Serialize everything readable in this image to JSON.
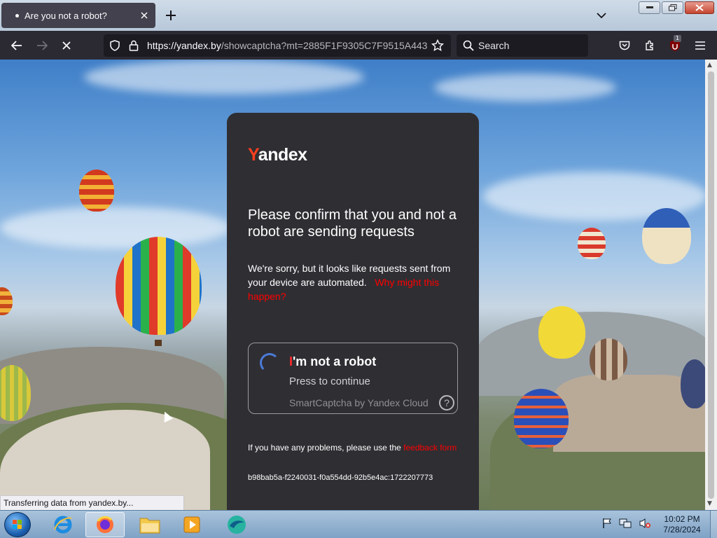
{
  "browser": {
    "tab_title": "Are you not a robot?",
    "url_domain": "https://yandex.by",
    "url_path": "/showcaptcha?mt=2885F1F9305C7F9515A443",
    "search_placeholder": "Search",
    "extension_badge": "1",
    "status_text": "Transferring data from yandex.by..."
  },
  "captcha": {
    "logo_first": "Y",
    "logo_rest": "andex",
    "heading": "Please confirm that you and not a robot are sending requests",
    "description": "We're sorry, but it looks like requests sent from your device are automated.",
    "why_link": "Why might this happen?",
    "checkbox_label_first": "I",
    "checkbox_label_rest": "'m not a robot",
    "press_label": "Press to continue",
    "provider": "SmartCaptcha by Yandex Cloud",
    "help_glyph": "?",
    "problems_text": "If you have any problems, please use the",
    "feedback_link": "feedback form",
    "request_id": "b98bab5a-f2240031-f0a554dd-92b5e4ac:1722207773"
  },
  "taskbar": {
    "time": "10:02 PM",
    "date": "7/28/2024",
    "apps": [
      "internet-explorer",
      "firefox",
      "file-explorer",
      "media-player",
      "browser-app"
    ]
  },
  "colors": {
    "yandex_red": "#fc3f1d",
    "link_red": "#ff0000",
    "card_bg": "#2f2e33",
    "spinner_blue": "#4b7bd8"
  }
}
